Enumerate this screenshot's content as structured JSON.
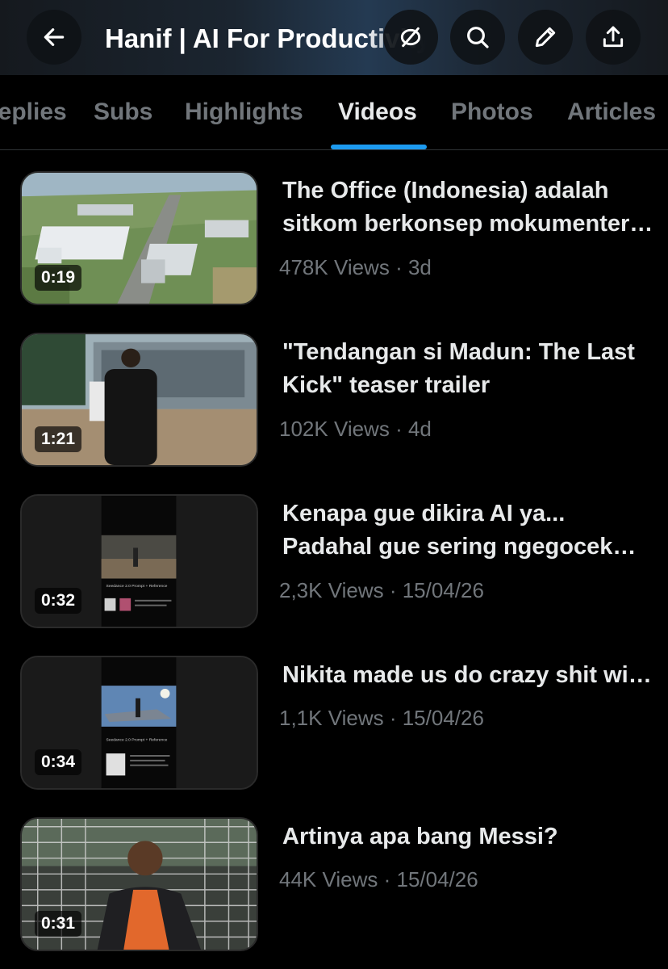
{
  "header": {
    "title": "Hanif | AI For Productivity",
    "buttons": {
      "back": "back-arrow-icon",
      "mute": "eye-slash-icon",
      "search": "search-icon",
      "edit": "pencil-icon",
      "share": "share-upload-icon"
    }
  },
  "tabs": [
    {
      "label": "Replies"
    },
    {
      "label": "Subs"
    },
    {
      "label": "Highlights"
    },
    {
      "label": "Videos",
      "active": true
    },
    {
      "label": "Photos"
    },
    {
      "label": "Articles"
    }
  ],
  "videos": [
    {
      "title": "The Office (Indonesia) adalah sitkom berkonsep mokumenter yang tayang di",
      "duration": "0:19",
      "views": "478K Views",
      "date": "3d"
    },
    {
      "title": "\"Tendangan si Madun: The Last Kick\" teaser trailer",
      "duration": "1:21",
      "views": "102K Views",
      "date": "4d"
    },
    {
      "title": "Kenapa gue dikira AI ya... Padahal gue sering ngegocek bola",
      "duration": "0:32",
      "views": "2,3K Views",
      "date": "15/04/26"
    },
    {
      "title": "Nikita made us do crazy shit with AI",
      "duration": "0:34",
      "views": "1,1K Views",
      "date": "15/04/26"
    },
    {
      "title": "Artinya apa bang Messi?",
      "duration": "0:31",
      "views": "44K Views",
      "date": "15/04/26"
    }
  ],
  "thumb_text": {
    "reference_caption": "Seedance 2.0 Prompt + Reference"
  },
  "colors": {
    "accent": "#1d9bf0",
    "muted": "#71767b",
    "text": "#e7e9ea"
  }
}
